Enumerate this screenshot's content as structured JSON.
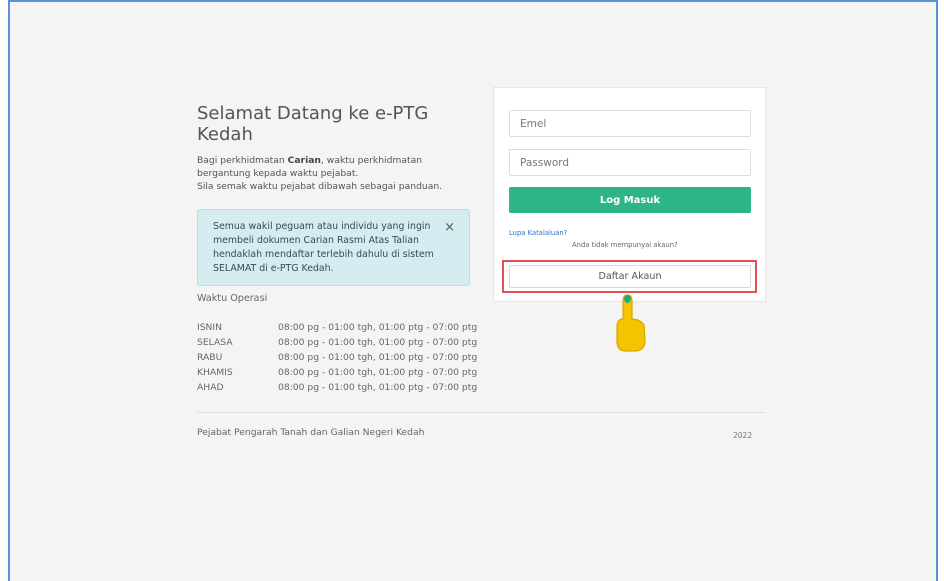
{
  "welcome": {
    "title": "Selamat Datang ke e-PTG Kedah",
    "intro_prefix": "Bagi perkhidmatan ",
    "intro_bold": "Carian",
    "intro_suffix": ", waktu perkhidmatan bergantung kepada waktu pejabat.",
    "intro_line2": "Sila semak waktu pejabat dibawah sebagai panduan."
  },
  "alert": {
    "text": "Semua wakil peguam atau individu yang ingin membeli dokumen Carian Rasmi Atas Talian hendaklah mendaftar terlebih dahulu di sistem SELAMAT di e-PTG Kedah.",
    "close_glyph": "×"
  },
  "operating_hours": {
    "title": "Waktu Operasi",
    "rows": [
      {
        "day": "ISNIN",
        "hours": "08:00 pg - 01:00 tgh, 01:00 ptg - 07:00 ptg"
      },
      {
        "day": "SELASA",
        "hours": "08:00 pg - 01:00 tgh, 01:00 ptg - 07:00 ptg"
      },
      {
        "day": "RABU",
        "hours": "08:00 pg - 01:00 tgh, 01:00 ptg - 07:00 ptg"
      },
      {
        "day": "KHAMIS",
        "hours": "08:00 pg - 01:00 tgh, 01:00 ptg - 07:00 ptg"
      },
      {
        "day": "AHAD",
        "hours": "08:00 pg - 01:00 tgh, 01:00 ptg - 07:00 ptg"
      }
    ]
  },
  "footer": {
    "organization": "Pejabat Pengarah Tanah dan Galian Negeri Kedah",
    "year": "2022"
  },
  "login": {
    "email_placeholder": "Emel",
    "email_value": "",
    "password_placeholder": "Password",
    "password_value": "",
    "submit_label": "Log Masuk",
    "forgot_label": "Lupa Katalaluan?",
    "no_account_text": "Anda tidak mempunyai akaun?",
    "register_label": "Daftar Akaun"
  },
  "colors": {
    "accent": "#2db585",
    "highlight": "#e05454",
    "pointer": "#f5c400",
    "alert_bg": "#d5ecf1"
  },
  "icons": {
    "alert_close": "close-icon",
    "cursor": "hand-pointer-icon"
  }
}
